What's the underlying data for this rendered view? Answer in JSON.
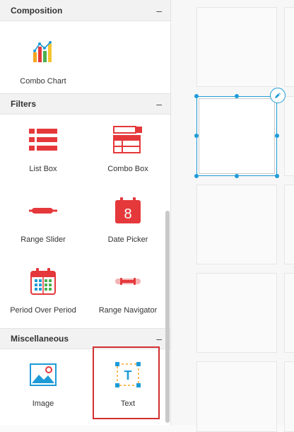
{
  "sections": {
    "composition": {
      "title": "Composition",
      "collapse": "–"
    },
    "filters": {
      "title": "Filters",
      "collapse": "–"
    },
    "miscellaneous": {
      "title": "Miscellaneous",
      "collapse": "–"
    }
  },
  "items": {
    "combo_chart": {
      "label": "Combo Chart",
      "icon": "combo-chart-icon"
    },
    "list_box": {
      "label": "List Box",
      "icon": "list-box-icon"
    },
    "combo_box": {
      "label": "Combo Box",
      "icon": "combo-box-icon"
    },
    "range_slider": {
      "label": "Range Slider",
      "icon": "range-slider-icon"
    },
    "date_picker": {
      "label": "Date Picker",
      "icon": "date-picker-icon",
      "day": "8"
    },
    "period_over_period": {
      "label": "Period Over Period",
      "icon": "period-over-period-icon"
    },
    "range_navigator": {
      "label": "Range Navigator",
      "icon": "range-navigator-icon"
    },
    "image": {
      "label": "Image",
      "icon": "image-icon"
    },
    "text": {
      "label": "Text",
      "icon": "text-icon",
      "glyph": "T"
    }
  },
  "colors": {
    "red": "#e5383b",
    "blue": "#1e9bd7",
    "highlight": "#d32f2f"
  }
}
